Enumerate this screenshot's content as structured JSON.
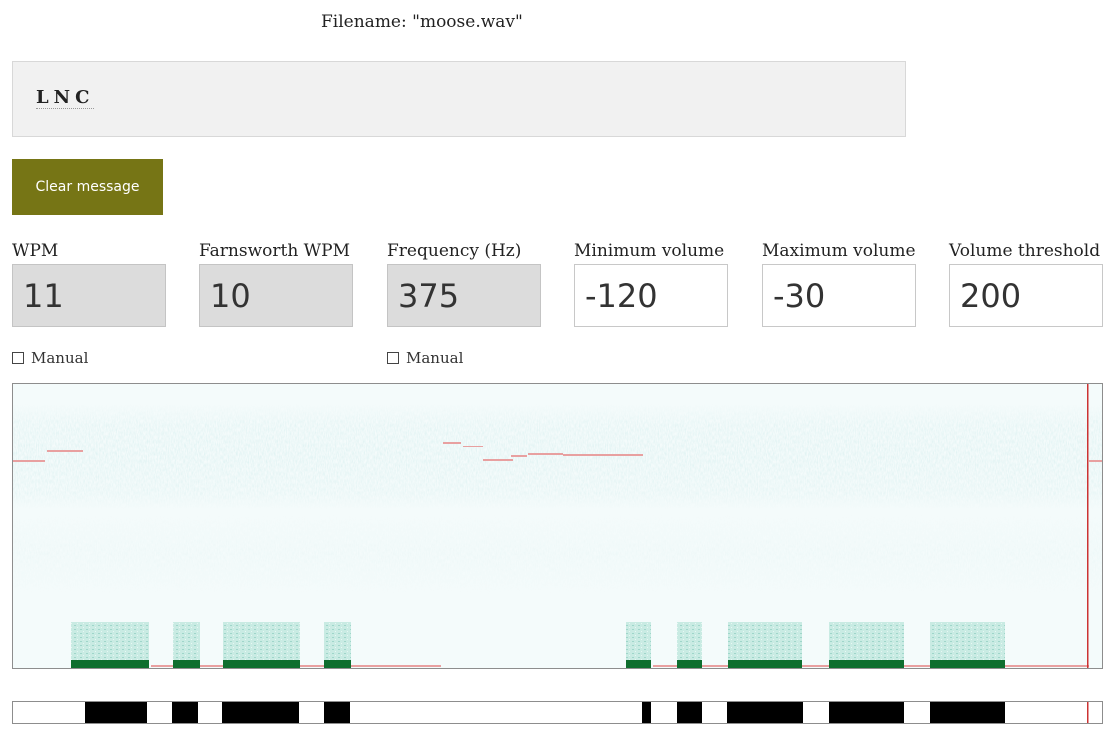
{
  "file": {
    "label": "Filename: \"moose.wav\""
  },
  "message": {
    "text": "LNC"
  },
  "buttons": {
    "clear": "Clear message"
  },
  "fields": [
    {
      "label": "WPM",
      "value": "11",
      "readonly": true
    },
    {
      "label": "Farnsworth WPM",
      "value": "10",
      "readonly": true
    },
    {
      "label": "Frequency (Hz)",
      "value": "375",
      "readonly": true
    },
    {
      "label": "Minimum volume",
      "value": "-120",
      "readonly": false
    },
    {
      "label": "Maximum volume",
      "value": "-30",
      "readonly": false
    },
    {
      "label": "Volume threshold",
      "value": "200",
      "readonly": false
    }
  ],
  "manual": {
    "wpm": "Manual",
    "frequency": "Manual"
  },
  "colors": {
    "button": "#767515",
    "spectrogram_bg": "#f4fbfb",
    "noise": "#b9e0e0",
    "signal": "#c8ece4",
    "signal_floor": "#0e6e2e",
    "trace": "#e8a0a0",
    "playhead": "#cc3333",
    "timeline_mark": "#000000"
  }
}
